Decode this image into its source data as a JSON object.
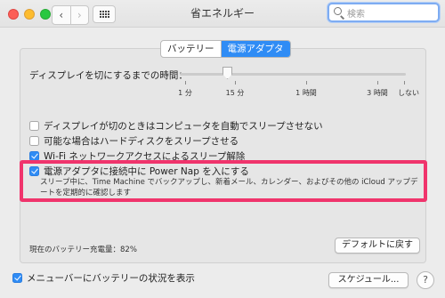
{
  "window": {
    "title": "省エネルギー"
  },
  "toolbar": {
    "back_glyph": "‹",
    "forward_glyph": "›",
    "grid_icon": "grid-icon",
    "search_placeholder": "検索"
  },
  "tabs": [
    {
      "label": "バッテリー",
      "selected": false
    },
    {
      "label": "電源アダプタ",
      "selected": true
    }
  ],
  "display_sleep": {
    "label": "ディスプレイを切にするまでの時間：",
    "ticks": [
      "1 分",
      "15 分",
      "1 時間",
      "3 時間",
      "しない"
    ],
    "value": "15 分"
  },
  "options": [
    {
      "label": "ディスプレイが切のときはコンピュータを自動でスリープさせない",
      "checked": false
    },
    {
      "label": "可能な場合はハードディスクをスリープさせる",
      "checked": false
    },
    {
      "label": "Wi-Fi ネットワークアクセスによるスリープ解除",
      "checked": true
    },
    {
      "label": "電源アダプタに接続中に Power Nap を入にする",
      "checked": true
    }
  ],
  "power_nap_description": "スリープ中に、Time Machine でバックアップし、新着メール、カレンダー、およびその他の iCloud アップデートを定期的に確認します",
  "battery": {
    "level_text": "現在のバッテリー充電量：82%"
  },
  "buttons": {
    "restore_defaults": "デフォルトに戻す",
    "schedule": "スケジュール...",
    "help": "?"
  },
  "menubar_option": {
    "label": "メニューバーにバッテリーの状況を表示",
    "checked": true
  },
  "colors": {
    "accent": "#2f8cf5",
    "highlight": "#f0346c"
  }
}
